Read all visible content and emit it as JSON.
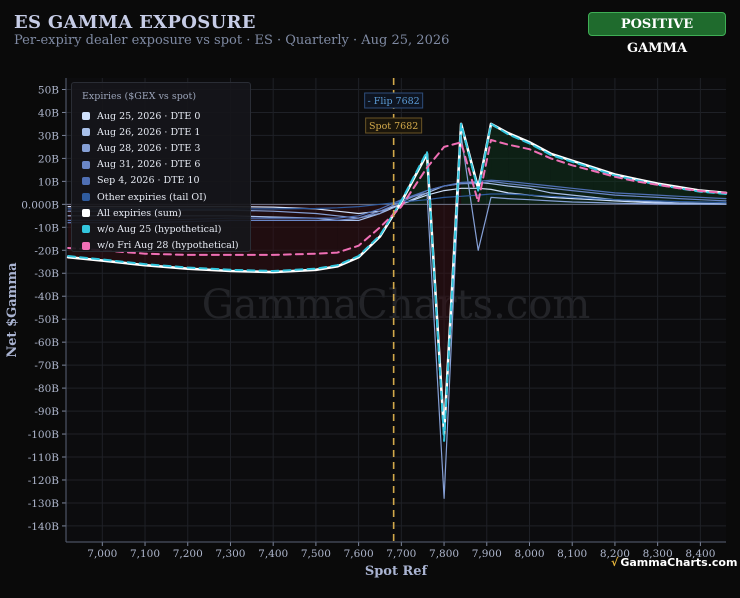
{
  "header": {
    "title": "ES GAMMA EXPOSURE",
    "subtitle": "Per-expiry dealer exposure vs spot · ES · Quarterly · Aug 25, 2026",
    "regime_badge": "POSITIVE GAMMA"
  },
  "branding": {
    "watermark": "GammaCharts.com",
    "footer": "GammaCharts.com",
    "footer_mark": "√"
  },
  "colors": {
    "background": "#0a0a0a",
    "positive_badge": "#1f6b2d",
    "spot_line": "#d2a94b",
    "flip_label": "#5b9bd5",
    "all_expiries": "#ffffff",
    "without_aug25": "#33c6de",
    "without_aug28": "#f06fb5"
  },
  "chart_data": {
    "type": "line",
    "xlabel": "Spot Ref",
    "ylabel": "Net $Gamma",
    "xlim": [
      6915,
      8460
    ],
    "ylim": [
      -147,
      55
    ],
    "x_ticks": [
      7000,
      7100,
      7200,
      7300,
      7400,
      7500,
      7600,
      7700,
      7800,
      7900,
      8000,
      8100,
      8200,
      8300,
      8400
    ],
    "x_tick_labels": [
      "7,000",
      "7,100",
      "7,200",
      "7,300",
      "7,400",
      "7,500",
      "7,600",
      "7,700",
      "7,800",
      "7,900",
      "8,000",
      "8,100",
      "8,200",
      "8,300",
      "8,400"
    ],
    "y_ticks": [
      50,
      40,
      30,
      20,
      10,
      0,
      -10,
      -20,
      -30,
      -40,
      -50,
      -60,
      -70,
      -80,
      -90,
      -100,
      -110,
      -120,
      -130,
      -140
    ],
    "y_tick_labels": [
      "50B",
      "40B",
      "30B",
      "20B",
      "10B",
      "0.000B",
      "-10B",
      "-20B",
      "-30B",
      "-40B",
      "-50B",
      "-60B",
      "-70B",
      "-80B",
      "-90B",
      "-100B",
      "-110B",
      "-120B",
      "-130B",
      "-140B"
    ],
    "grid": true,
    "legend_title": "Expiries ($GEX vs spot)",
    "legend_position": "top-left",
    "spot": {
      "x": 7682,
      "label": "Spot 7682"
    },
    "flip": {
      "x": 7682,
      "label": "- Flip 7682"
    },
    "x": [
      6920,
      7000,
      7100,
      7200,
      7300,
      7400,
      7500,
      7550,
      7600,
      7650,
      7700,
      7760,
      7800,
      7840,
      7880,
      7910,
      7950,
      8000,
      8050,
      8100,
      8150,
      8200,
      8250,
      8300,
      8350,
      8400,
      8460
    ],
    "series": [
      {
        "name": "Aug 25, 2026 · DTE 0",
        "color": "#cfe0fb",
        "width": 1.2,
        "dash": false,
        "values": [
          -1,
          -1,
          -1,
          -1,
          -1,
          -1.2,
          -2,
          -3,
          -4,
          -3,
          0,
          4,
          6,
          7,
          7,
          6.5,
          5,
          4,
          3,
          2.5,
          2,
          1.5,
          1,
          0.6,
          0.3,
          0.2,
          0.1
        ]
      },
      {
        "name": "Aug 26, 2026 · DTE 1",
        "color": "#a9c0ea",
        "width": 1.2,
        "dash": false,
        "values": [
          -5,
          -5,
          -5,
          -5,
          -5,
          -5.5,
          -6,
          -7,
          -7,
          -4,
          0,
          5,
          8,
          9,
          9.5,
          9,
          8,
          7,
          5,
          4,
          3,
          2,
          1.5,
          1,
          0.6,
          0.4,
          0.2
        ]
      },
      {
        "name": "Aug 28, 2026 · DTE 3",
        "color": "#86a0d6",
        "width": 1.2,
        "dash": false,
        "values": [
          -3,
          -3,
          -3,
          -2.5,
          -2.5,
          -3,
          -4,
          -5,
          -6,
          -4,
          2,
          5,
          -128,
          30,
          -20,
          3,
          2.5,
          2,
          1.5,
          1,
          0.8,
          0.5,
          0.3,
          0.2,
          0.1,
          0.05,
          0
        ]
      },
      {
        "name": "Aug 31, 2026 · DTE 6",
        "color": "#6a86c6",
        "width": 1.2,
        "dash": false,
        "values": [
          -8,
          -8,
          -8,
          -7.5,
          -7,
          -7,
          -7,
          -7,
          -6,
          -3,
          1,
          6,
          8,
          9,
          9,
          10,
          9,
          8,
          7,
          6,
          5,
          4,
          3.5,
          3,
          2.5,
          2,
          1.5
        ]
      },
      {
        "name": "Sep 4, 2026 · DTE 10",
        "color": "#4f6fb4",
        "width": 1.2,
        "dash": false,
        "values": [
          -7,
          -7,
          -7,
          -6.5,
          -6,
          -6,
          -6,
          -6,
          -5,
          -2,
          2,
          6,
          8,
          9.5,
          10,
          10.5,
          10,
          9,
          8,
          7,
          6,
          5,
          4.5,
          4,
          3.5,
          3,
          2.5
        ]
      },
      {
        "name": "Other expiries (tail OI)",
        "color": "#2f5b9e",
        "width": 1.2,
        "dash": false,
        "values": [
          -2,
          -2,
          -2,
          -2,
          -2,
          -2,
          -1.8,
          -1.5,
          -1,
          0,
          1,
          2,
          3,
          3.5,
          4,
          4.5,
          4.5,
          4,
          3.5,
          3,
          2.5,
          2,
          1.8,
          1.5,
          1.2,
          1,
          0.8
        ]
      },
      {
        "name": "All expiries (sum)",
        "color": "#ffffff",
        "width": 2.6,
        "dash": false,
        "values": [
          -23,
          -24.5,
          -26.5,
          -28,
          -29,
          -29.5,
          -28.5,
          -27,
          -23,
          -14,
          1,
          22,
          -100,
          35,
          7,
          35,
          31,
          27,
          22,
          19,
          16,
          13,
          11,
          9,
          7.5,
          6,
          5
        ]
      },
      {
        "name": "w/o Aug 25 (hypothetical)",
        "color": "#33c6de",
        "width": 2,
        "dash": true,
        "values": [
          -22.5,
          -24,
          -26,
          -27.5,
          -28.5,
          -29,
          -28,
          -26.5,
          -22.5,
          -13.5,
          1.5,
          23,
          -103,
          35,
          6,
          35,
          30.5,
          26.5,
          21.5,
          18.5,
          15.5,
          12.5,
          10.5,
          8.5,
          7,
          5.5,
          4.5
        ]
      },
      {
        "name": "w/o Fri Aug 28 (hypothetical)",
        "color": "#f06fb5",
        "width": 2,
        "dash": true,
        "values": [
          -19,
          -20,
          -21.5,
          -22,
          -22,
          -22,
          -21.5,
          -21,
          -18,
          -10,
          -1,
          16,
          25,
          27,
          1,
          28,
          26,
          24,
          20,
          17,
          14.5,
          12,
          10,
          8.5,
          7,
          5.8,
          5
        ]
      }
    ]
  }
}
